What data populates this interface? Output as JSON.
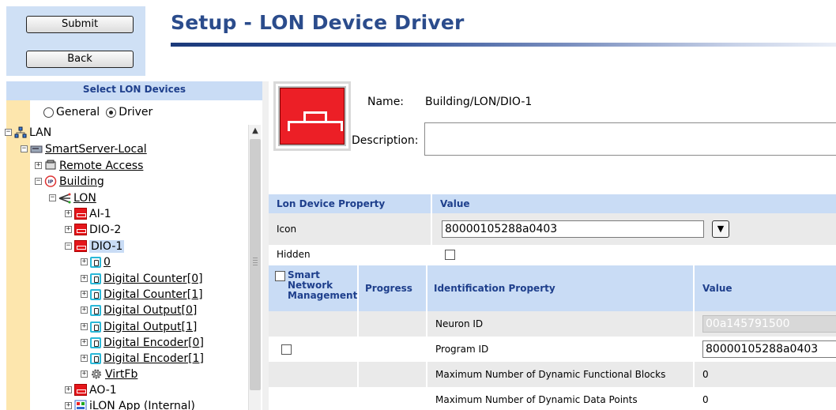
{
  "header": {
    "submit_label": "Submit",
    "back_label": "Back",
    "title": "Setup - LON Device Driver"
  },
  "tree": {
    "heading": "Select LON Devices",
    "radio_general": "General",
    "radio_driver": "Driver",
    "items": [
      {
        "label": "LAN",
        "expander": "−",
        "icon": "network-icon"
      },
      {
        "label": "SmartServer-Local",
        "expander": "−",
        "icon": "server-icon"
      },
      {
        "label": "Remote Access",
        "expander": "+",
        "icon": "phone-icon"
      },
      {
        "label": "Building",
        "expander": "−",
        "icon": "building-channel-icon"
      },
      {
        "label": "LON",
        "expander": "−",
        "icon": "lon-channel-icon"
      },
      {
        "label": "AI-1",
        "expander": "+",
        "icon": "device-icon"
      },
      {
        "label": "DIO-2",
        "expander": "+",
        "icon": "device-icon"
      },
      {
        "label": "DIO-1",
        "expander": "−",
        "icon": "device-icon"
      },
      {
        "label": "0",
        "expander": "+",
        "icon": "functional-block-icon"
      },
      {
        "label": "Digital Counter[0]",
        "expander": "+",
        "icon": "functional-block-icon"
      },
      {
        "label": "Digital Counter[1]",
        "expander": "+",
        "icon": "functional-block-icon"
      },
      {
        "label": "Digital Output[0]",
        "expander": "+",
        "icon": "functional-block-icon"
      },
      {
        "label": "Digital Output[1]",
        "expander": "+",
        "icon": "functional-block-icon"
      },
      {
        "label": "Digital Encoder[0]",
        "expander": "+",
        "icon": "functional-block-icon"
      },
      {
        "label": "Digital Encoder[1]",
        "expander": "+",
        "icon": "functional-block-icon"
      },
      {
        "label": "VirtFb",
        "expander": "+",
        "icon": "gear-icon"
      },
      {
        "label": "AO-1",
        "expander": "+",
        "icon": "device-icon"
      },
      {
        "label": "iLON App (Internal)",
        "expander": "+",
        "icon": "app-icon"
      }
    ]
  },
  "detail": {
    "name_label": "Name:",
    "name_value": "Building/LON/DIO-1",
    "description_label": "Description:",
    "description_value": "",
    "prop_header": "Lon Device Property",
    "value_header": "Value",
    "icon_label": "Icon",
    "icon_value": "80000105288a0403",
    "hidden_label": "Hidden",
    "smart_mgmt_header": "Smart Network Management",
    "progress_header": "Progress",
    "id_prop_header": "Identification Property",
    "id_value_header": "Value",
    "neuron_id_label": "Neuron ID",
    "neuron_id_value": "00a145791500",
    "program_id_label": "Program ID",
    "program_id_value": "80000105288a0403",
    "max_fb_label": "Maximum Number of Dynamic Functional Blocks",
    "max_fb_value": "0",
    "max_dp_label": "Maximum Number of Dynamic Data Points",
    "max_dp_value": "0"
  },
  "colors": {
    "title": "#2b4c8c",
    "header_bg": "#c9dcf5",
    "gutter": "#fde6ad",
    "device_red": "#e5161b"
  }
}
